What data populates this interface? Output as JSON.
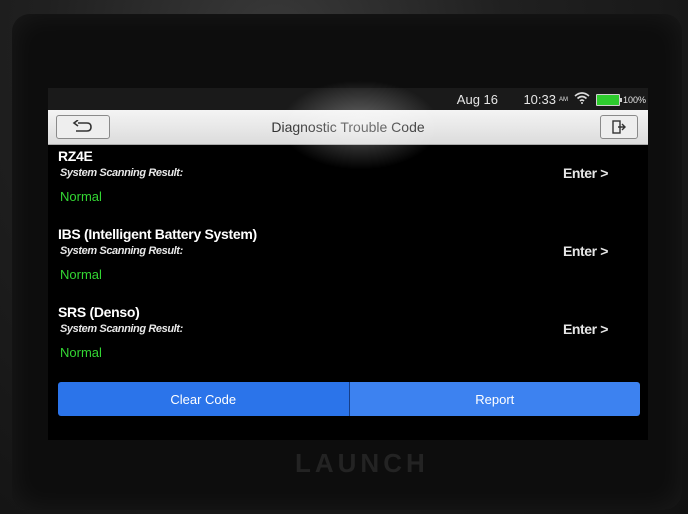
{
  "status": {
    "date": "Aug 16",
    "time": "10:33",
    "ampm": "AM",
    "battery": "100%"
  },
  "header": {
    "title": "Diagnostic Trouble Code"
  },
  "systems": [
    {
      "name": "RZ4E",
      "label": "System Scanning Result:",
      "status": "Normal",
      "action": "Enter >"
    },
    {
      "name": "IBS (Intelligent Battery System)",
      "label": "System Scanning Result:",
      "status": "Normal",
      "action": "Enter >"
    },
    {
      "name": "SRS (Denso)",
      "label": "System Scanning Result:",
      "status": "Normal",
      "action": "Enter >"
    }
  ],
  "footer": {
    "clear_label": "Clear Code",
    "report_label": "Report"
  },
  "brand": "LAUNCH",
  "colors": {
    "accent": "#2b74ea",
    "status_ok": "#33d633",
    "battery": "#2ecc2e"
  }
}
